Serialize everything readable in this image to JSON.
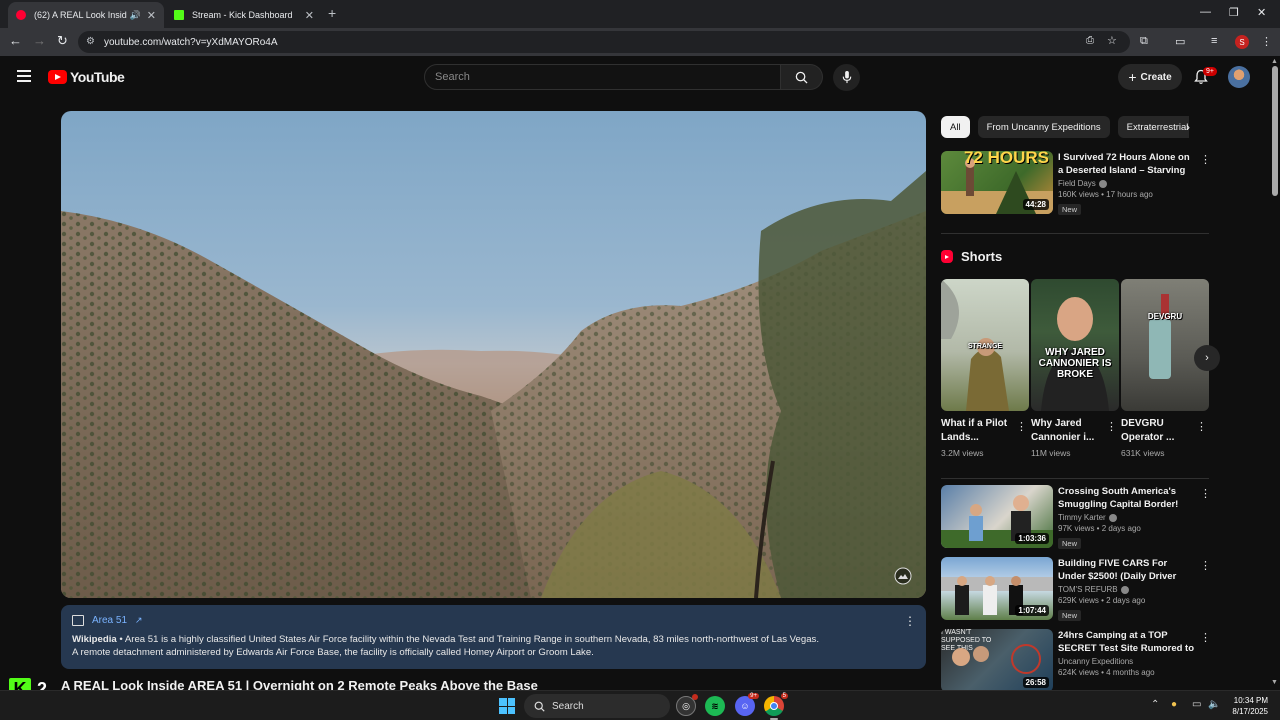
{
  "browser": {
    "tabs": [
      {
        "title": "(62) A REAL Look Inside ARE",
        "active": true,
        "favicon_color": "#ff0033"
      },
      {
        "title": "Stream - Kick Dashboard",
        "active": false,
        "favicon_color": "#53fc18"
      }
    ],
    "url": "youtube.com/watch?v=yXdMAYORo4A",
    "profile_initial": "S"
  },
  "header": {
    "logo_text": "YouTube",
    "search_placeholder": "Search",
    "create_label": "Create",
    "notifications_badge": "9+"
  },
  "info_panel": {
    "topic": "Area 51",
    "source": "Wikipedia",
    "line1": " • Area 51 is a highly classified United States Air Force facility within the Nevada Test and Training Range in southern Nevada, 83 miles north-northwest of Las Vegas.",
    "line2": "A remote detachment administered by Edwards Air Force Base, the facility is officially called Homey Airport or Groom Lake."
  },
  "video_title": "A REAL Look Inside AREA 51 | Overnight on 2 Remote Peaks Above the Base",
  "kick_overlay": {
    "count": "2"
  },
  "chips": [
    "All",
    "From Uncanny Expeditions",
    "Extraterrestrial"
  ],
  "recommendations_top": [
    {
      "title": "I Survived 72 Hours Alone on a Deserted Island – Starving an...",
      "channel": "Field Days",
      "stats": "160K views • 17 hours ago",
      "duration": "44:28",
      "badge": "New",
      "thumb_text": "72 HOURS"
    }
  ],
  "shorts": {
    "heading": "Shorts",
    "items": [
      {
        "title": "What if a Pilot Lands...",
        "views": "3.2M views",
        "overlay": "STRANGE"
      },
      {
        "title": "Why Jared Cannonier i...",
        "views": "11M views",
        "overlay": "WHY JARED CANNONIER IS BROKE"
      },
      {
        "title": "DEVGRU Operator ...",
        "views": "631K views",
        "overlay": "DEVGRU"
      }
    ]
  },
  "recommendations": [
    {
      "title": "Crossing South America's Smuggling Capital Border!",
      "channel": "Timmy Karter",
      "stats": "97K views • 2 days ago",
      "duration": "1:03:36",
      "badge": "New"
    },
    {
      "title": "Building FIVE CARS For Under $2500! (Daily Driver Challenge...",
      "channel": "TOM'S REFURB",
      "stats": "629K views • 2 days ago",
      "duration": "1:07:44",
      "badge": "New"
    },
    {
      "title": "24hrs Camping at a TOP SECRET Test Site Rumored to ...",
      "channel": "Uncanny Expeditions",
      "stats": "624K views • 4 months ago",
      "duration": "26:58",
      "badge": "",
      "thumb_text": "I WASN'T SUPPOSED TO SEE THIS"
    }
  ],
  "taskbar": {
    "search_label": "Search",
    "time": "10:34 PM",
    "date": "8/17/2025",
    "discord_badge": "9+",
    "chrome_badge": "5"
  }
}
